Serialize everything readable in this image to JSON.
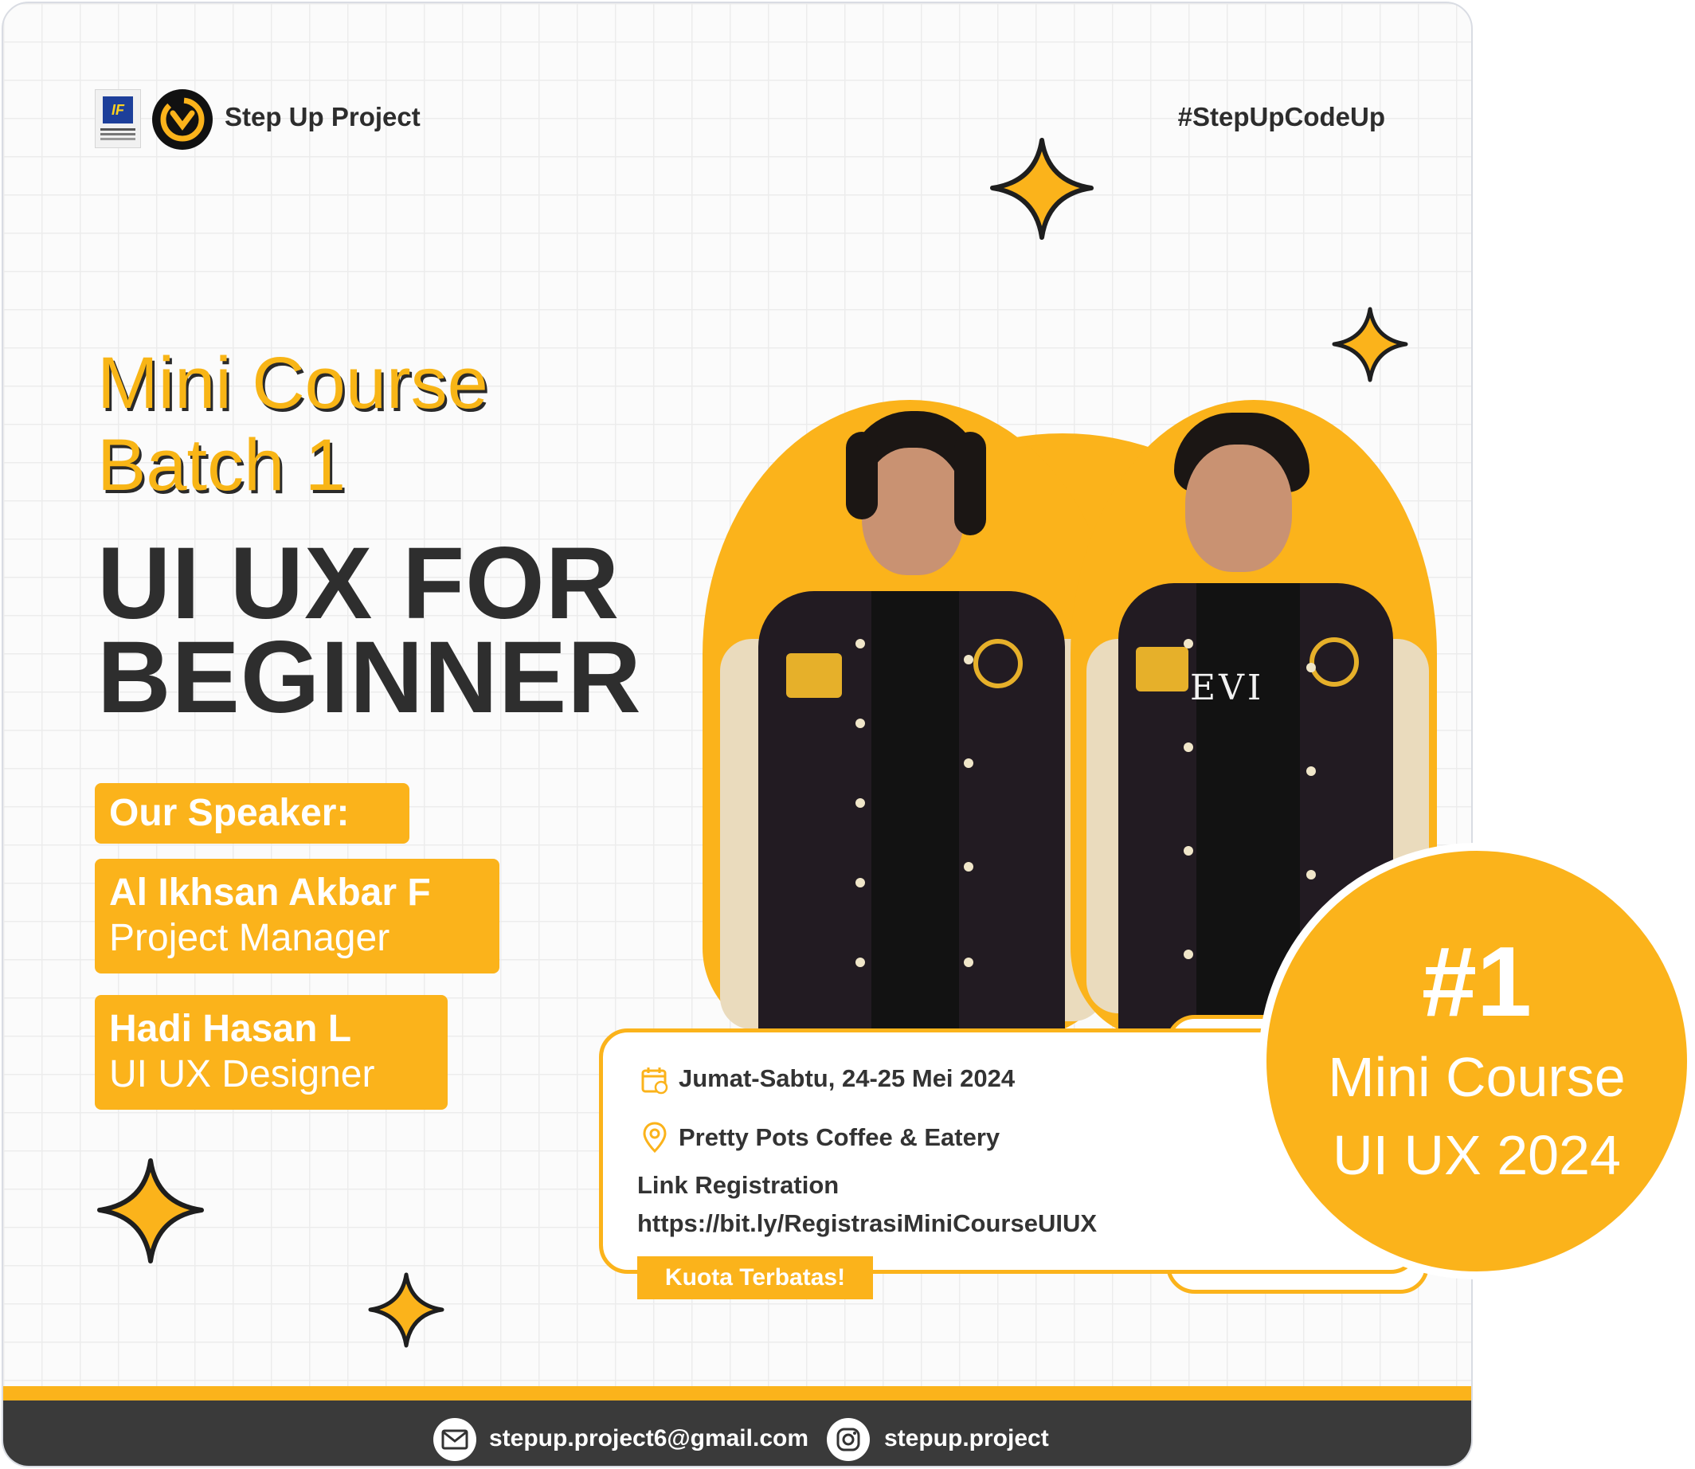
{
  "header": {
    "brand_name": "Step Up Project",
    "hashtag": "#StepUpCodeUp"
  },
  "headline": {
    "line1": "Mini Course",
    "line2": "Batch 1",
    "title_line1": "UI UX FOR",
    "title_line2": "BEGINNER"
  },
  "speakers": {
    "heading": "Our Speaker:",
    "items": [
      {
        "name": "Al Ikhsan Akbar F",
        "role": "Project Manager"
      },
      {
        "name": "Hadi Hasan L",
        "role": "UI UX Designer"
      }
    ]
  },
  "event": {
    "date": "Jumat-Sabtu, 24-25 Mei 2024",
    "location": "Pretty Pots Coffee & Eatery",
    "link_label": "Link Registration",
    "link_url": "https://bit.ly/RegistrasiMiniCourseUIUX",
    "quota_label": "Kuota Terbatas!"
  },
  "jacket_text": "EVI",
  "footer": {
    "email": "stepup.project6@gmail.com",
    "instagram": "stepup.project"
  },
  "badge": {
    "number": "#1",
    "line1": "Mini Course",
    "line2": "UI UX 2024"
  },
  "colors": {
    "accent": "#fbb31b",
    "dark": "#2e2e2e",
    "footer_bg": "#3a3a3a"
  },
  "icons": [
    "calendar-icon",
    "location-pin-icon",
    "mail-icon",
    "instagram-icon",
    "sparkle-icon",
    "qr-code"
  ]
}
